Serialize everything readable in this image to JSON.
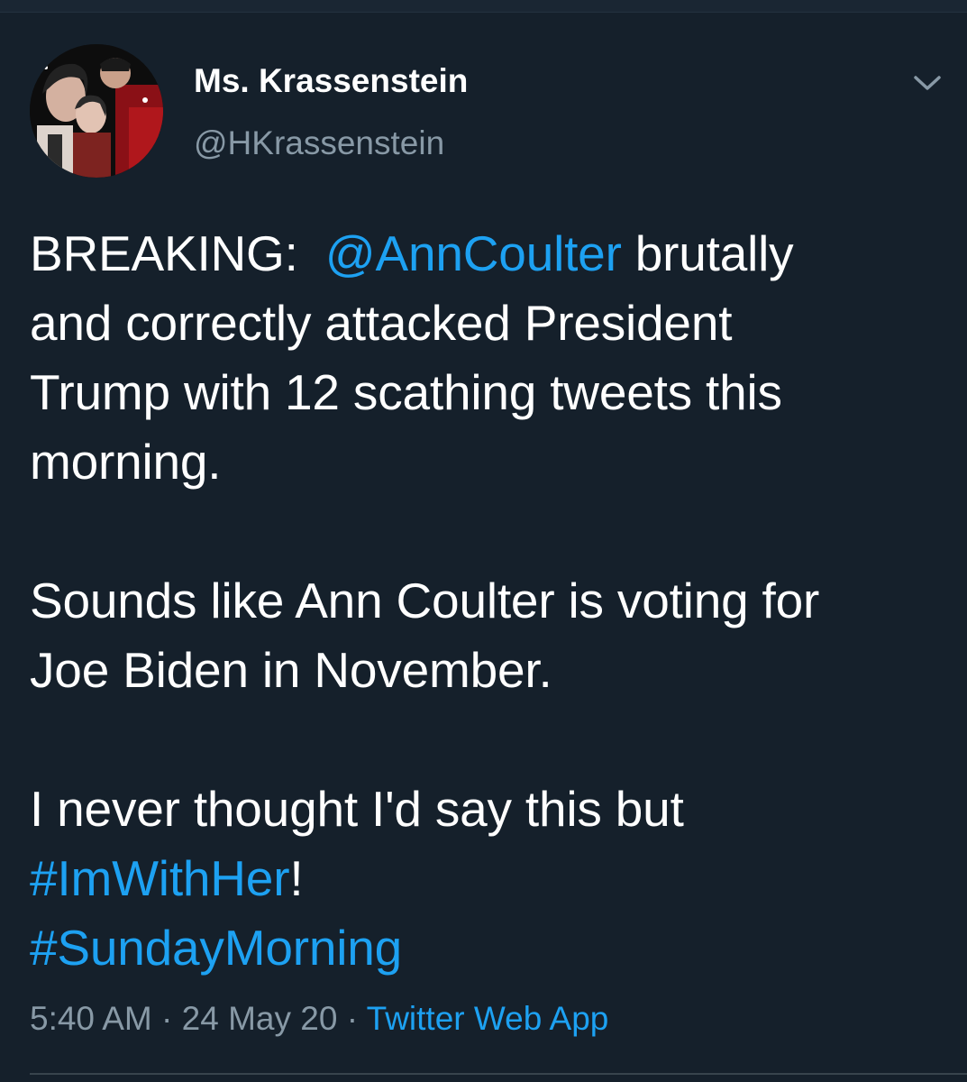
{
  "tweet": {
    "display_name": "Ms. Krassenstein",
    "handle": "@HKrassenstein",
    "menu_icon": "chevron-down-icon",
    "avatar_icon": "profile-photo",
    "text": {
      "p1": {
        "prefix": "BREAKING:  ",
        "mention": "@AnnCoulter",
        "line1_suffix": " brutally",
        "line2": "and correctly attacked President",
        "line3": "Trump with 12 scathing tweets this",
        "line4": "morning."
      },
      "p2": {
        "line1": "Sounds like Ann Coulter is voting for",
        "line2": "Joe Biden in November."
      },
      "p3": {
        "line1": "I never thought I'd say this but",
        "hashtag1": "#ImWithHer",
        "hashtag1_suffix": "!",
        "hashtag2": "#SundayMorning"
      }
    },
    "meta": {
      "time": "5:40 AM",
      "separator": " · ",
      "date": "24 May 20",
      "source": "Twitter Web App"
    }
  },
  "colors": {
    "background": "#15202b",
    "text": "#ffffff",
    "secondary_text": "#8899a6",
    "link": "#1da1f2",
    "divider": "#38444d"
  }
}
